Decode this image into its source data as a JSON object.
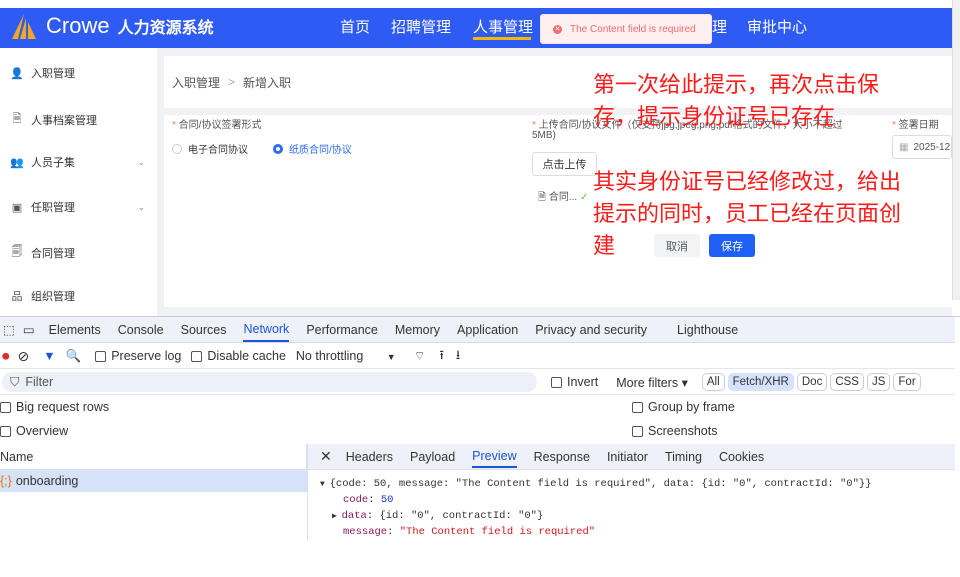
{
  "header": {
    "brand": "Crowe",
    "system_name": "人力资源系统",
    "nav": [
      "首页",
      "招聘管理",
      "人事管理",
      "理",
      "审批中心"
    ],
    "active_nav": "人事管理",
    "toast": "The Content field is required"
  },
  "sidebar": {
    "items": [
      {
        "label": "入职管理",
        "icon": "user-add-icon"
      },
      {
        "label": "人事档案管理",
        "icon": "document-icon"
      },
      {
        "label": "人员子集",
        "icon": "users-icon",
        "expandable": true
      },
      {
        "label": "任职管理",
        "icon": "briefcase-icon",
        "expandable": true
      },
      {
        "label": "合同管理",
        "icon": "contract-icon"
      },
      {
        "label": "组织管理",
        "icon": "org-icon"
      }
    ]
  },
  "breadcrumb": {
    "parent": "入职管理",
    "separator": ">",
    "current": "新增入职"
  },
  "form": {
    "sign_type_label": "合同/协议签署形式",
    "options": [
      "电子合同协议",
      "纸质合同/协议"
    ],
    "selected_option": "纸质合同/协议",
    "upload_label": "上传合同/协议文件（仅支持jpg,jpeg,png,pdf格式的文件，大小不超过",
    "upload_label_2": "5MB)",
    "upload_button": "点击上传",
    "uploaded_file": "合同...",
    "sign_date_label": "签署日期",
    "sign_date_value": "2025-12",
    "cancel": "取消",
    "save": "保存"
  },
  "annotations": {
    "line1": "第一次给此提示，再次点击保",
    "line2": "存，提示身份证号已存在",
    "line3": "其实身份证号已经修改过，给出",
    "line4": "提示的同时，员工已经在页面创",
    "line5": "建"
  },
  "devtools": {
    "tabs": [
      "Elements",
      "Console",
      "Sources",
      "Network",
      "Performance",
      "Memory",
      "Application",
      "Privacy and security",
      "Lighthouse"
    ],
    "active_tab": "Network",
    "toolbar": {
      "preserve_log": "Preserve log",
      "disable_cache": "Disable cache",
      "throttling": "No throttling"
    },
    "filter": {
      "placeholder": "Filter",
      "invert": "Invert",
      "more_filters": "More filters",
      "types": [
        "All",
        "Fetch/XHR",
        "Doc",
        "CSS",
        "JS",
        "For"
      ],
      "active_type": "Fetch/XHR"
    },
    "options": {
      "big_rows": "Big request rows",
      "overview": "Overview",
      "group_by_frame": "Group by frame",
      "screenshots": "Screenshots"
    },
    "requests": {
      "header": "Name",
      "rows": [
        "onboarding"
      ]
    },
    "detail_tabs": [
      "Headers",
      "Payload",
      "Preview",
      "Response",
      "Initiator",
      "Timing",
      "Cookies"
    ],
    "active_detail_tab": "Preview",
    "preview": {
      "summary": "{code: 50, message: \"The Content field is required\", data: {id: \"0\", contractId: \"0\"}}",
      "code_key": "code",
      "code_value": "50",
      "data_key": "data",
      "data_value": "{id: \"0\", contractId: \"0\"}",
      "message_key": "message",
      "message_value": "\"The Content field is required\""
    }
  }
}
